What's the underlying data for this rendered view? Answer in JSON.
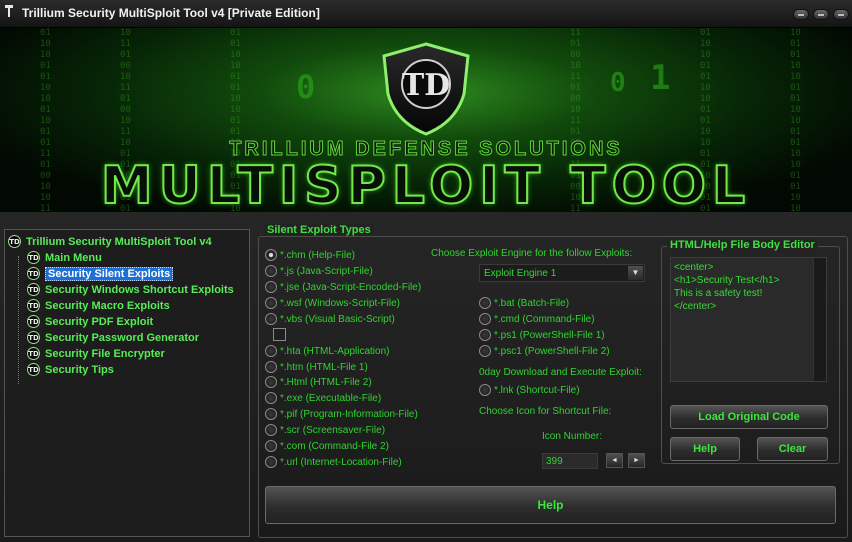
{
  "window": {
    "title": "Trillium Security MultiSploit Tool v4 [Private Edition]"
  },
  "banner": {
    "logo_text": "TD",
    "company": "TRILLIUM DEFENSE SOLUTIONS",
    "product": "MULTISPLOIT TOOL"
  },
  "tree": {
    "root": "Trillium Security MultiSploit Tool v4",
    "items": [
      {
        "label": "Main Menu"
      },
      {
        "label": "Security Silent Exploits"
      },
      {
        "label": "Security Windows Shortcut Exploits"
      },
      {
        "label": "Security Macro Exploits"
      },
      {
        "label": "Security PDF Exploit"
      },
      {
        "label": "Security Password Generator"
      },
      {
        "label": "Security File Encrypter"
      },
      {
        "label": "Security Tips"
      }
    ],
    "selected": "Security Silent Exploits",
    "icon_text": "TD"
  },
  "exploit_types": {
    "title": "Silent Exploit Types",
    "options": [
      {
        "label": "*.chm (Help-File)",
        "checked": true
      },
      {
        "label": "*.js (Java-Script-File)",
        "checked": false
      },
      {
        "label": "*.jse (Java-Script-Encoded-File)",
        "checked": false
      },
      {
        "label": "*.wsf (Windows-Script-File)",
        "checked": false
      },
      {
        "label": "*.vbs (Visual Basic-Script)",
        "checked": false
      },
      {
        "label": "*.hta (HTML-Application)",
        "checked": false
      },
      {
        "label": "*.htm (HTML-File 1)",
        "checked": false
      },
      {
        "label": "*.Html (HTML-File 2)",
        "checked": false
      },
      {
        "label": "*.exe (Executable-File)",
        "checked": false
      },
      {
        "label": "*.pif (Program-Information-File)",
        "checked": false
      },
      {
        "label": "*.scr (Screensaver-File)",
        "checked": false
      },
      {
        "label": "*.com (Command-File 2)",
        "checked": false
      },
      {
        "label": "*.url (Internet-Location-File)",
        "checked": false
      }
    ]
  },
  "engine": {
    "label": "Choose Exploit Engine for the follow Exploits:",
    "selected": "Exploit Engine 1",
    "options": [
      {
        "label": "*.bat (Batch-File)"
      },
      {
        "label": "*.cmd (Command-File)"
      },
      {
        "label": "*.ps1 (PowerShell-File 1)"
      },
      {
        "label": "*.psc1 (PowerShell-File 2)"
      }
    ]
  },
  "zero_day": {
    "label": "0day Download and Execute Exploit:",
    "option": "*.lnk (Shortcut-File)"
  },
  "icon": {
    "label": "Choose Icon for Shortcut File:",
    "number_label": "Icon Number:",
    "number_value": "399"
  },
  "editor": {
    "title": "HTML/Help File Body Editor",
    "lines": [
      "<center>",
      "<h1>Security Test</h1>",
      "This is a safety test!",
      "</center>"
    ]
  },
  "buttons": {
    "load_original": "Load Original Code",
    "help_small": "Help",
    "clear": "Clear",
    "help_main": "Help"
  },
  "colors": {
    "accent_green": "#2fd42f",
    "selection_blue": "#1e6fd4",
    "background": "#1c1c1c"
  }
}
